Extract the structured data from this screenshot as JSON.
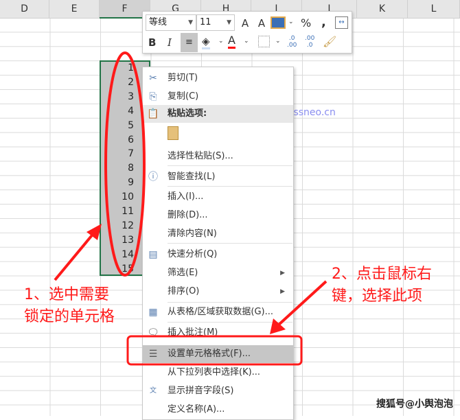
{
  "columns": [
    "D",
    "E",
    "F",
    "G",
    "H",
    "I",
    "J",
    "K",
    "L"
  ],
  "cells": [
    "1",
    "2",
    "3",
    "4",
    "5",
    "6",
    "7",
    "8",
    "9",
    "10",
    "11",
    "12",
    "13",
    "14",
    "15"
  ],
  "mini_toolbar": {
    "font": "等线",
    "size": "11",
    "grow": "A",
    "shrink": "A",
    "percent": "%",
    "comma": ",",
    "bold": "B",
    "italic": "I",
    "font_color": "A",
    "inc_dec": ".0\n.00",
    "dec_dec": ".00\n.0",
    "font_color_hex": "#ff0000"
  },
  "menu": {
    "cut": "剪切(T)",
    "copy": "复制(C)",
    "paste_options": "粘贴选项:",
    "paste_special": "选择性粘贴(S)...",
    "smart_lookup": "智能查找(L)",
    "insert": "插入(I)...",
    "delete": "删除(D)...",
    "clear": "清除内容(N)",
    "quick_analysis": "快速分析(Q)",
    "filter": "筛选(E)",
    "sort": "排序(O)",
    "get_data": "从表格/区域获取数据(G)...",
    "insert_comment": "插入批注(M)",
    "format_cells": "设置单元格格式(F)...",
    "pick_list": "从下拉列表中选择(K)...",
    "phonetic": "显示拼音字段(S)",
    "define_name": "定义名称(A)..."
  },
  "annotations": {
    "step1_line1": "1、选中需要",
    "step1_line2": "锁定的单元格",
    "step2_line1": "2、点击鼠标右",
    "step2_line2": "键，选择此项",
    "color": "#ff1a1a"
  },
  "watermark": "passneo.cn",
  "credit": "搜狐号@小舆泡泡"
}
